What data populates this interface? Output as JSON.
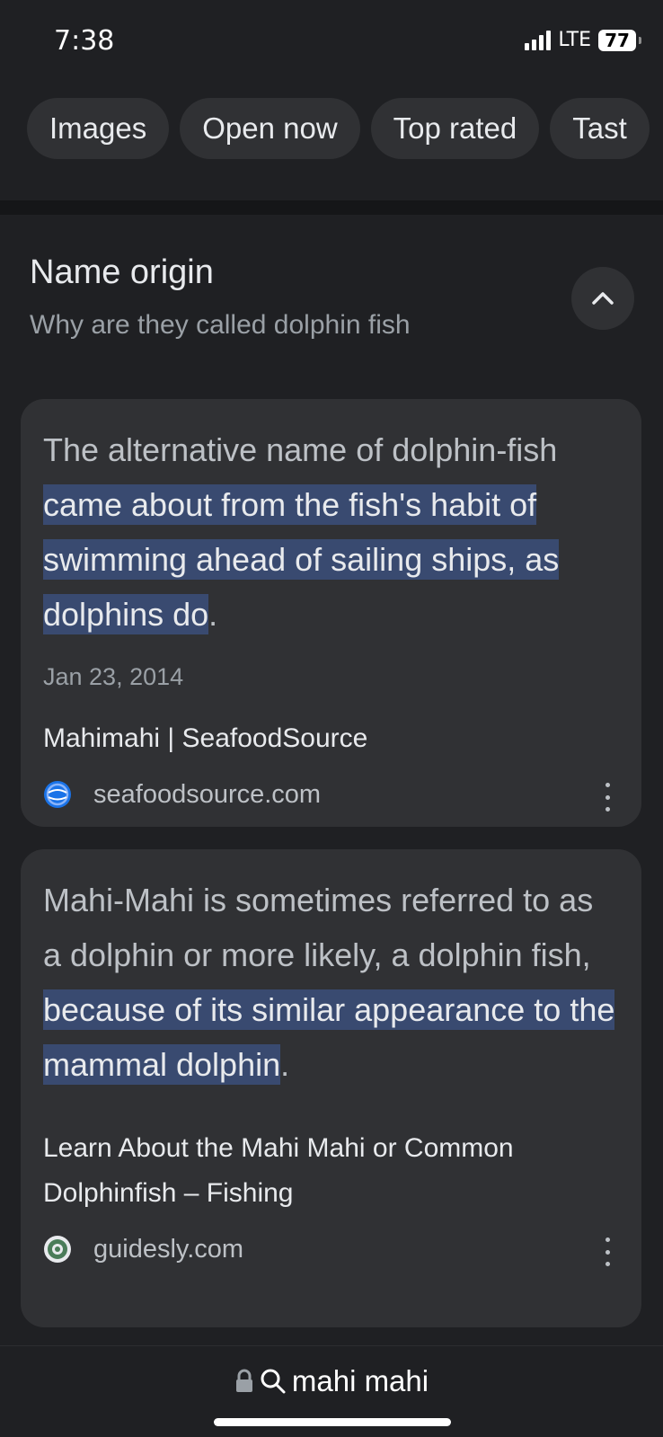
{
  "status_bar": {
    "time": "7:38",
    "network": "LTE",
    "battery": "77"
  },
  "chips": [
    {
      "label": "Images"
    },
    {
      "label": "Open now"
    },
    {
      "label": "Top rated"
    },
    {
      "label": "Tast"
    }
  ],
  "section": {
    "title": "Name origin",
    "subtitle": "Why are they called dolphin fish"
  },
  "results": [
    {
      "snippet_plain": "The alternative name of dolphin-fish ",
      "snippet_highlight": "came about from the fish's habit of swimming ahead of sailing ships, as dolphins do",
      "snippet_end": ".",
      "date": "Jan 23, 2014",
      "title": "Mahimahi | SeafoodSource",
      "domain": "seafoodsource.com",
      "favicon": "seafoodsource-globe-icon"
    },
    {
      "snippet_plain": "Mahi-Mahi is sometimes referred to as a dolphin or more likely, a dolphin fish, ",
      "snippet_highlight": "because of its similar appearance to the mammal dolphin",
      "snippet_end": ".",
      "title": "Learn About the Mahi Mahi or Common Dolphinfish – Fishing",
      "domain": "guidesly.com",
      "favicon": "guidesly-logo-icon"
    }
  ],
  "address_bar": {
    "query": "mahi mahi"
  },
  "colors": {
    "background": "#1f2023",
    "card": "#303134",
    "highlight": "#394a70"
  }
}
